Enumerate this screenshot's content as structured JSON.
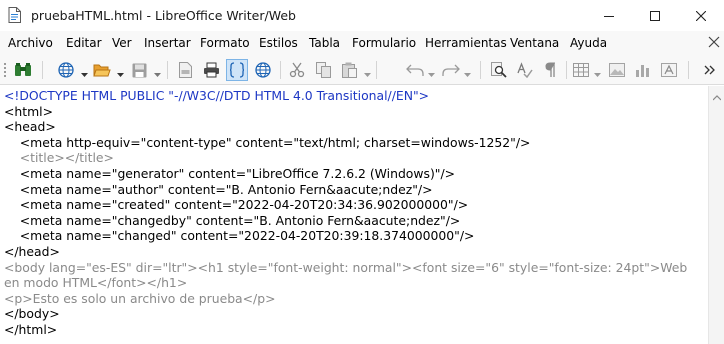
{
  "window": {
    "title": "pruebaHTML.html - LibreOffice Writer/Web",
    "icon": "document-html-icon",
    "controls": [
      "minimize-icon",
      "maximize-icon",
      "close-icon"
    ]
  },
  "menu": {
    "items": [
      "Archivo",
      "Editar",
      "Ver",
      "Insertar",
      "Formato",
      "Estilos",
      "Tabla",
      "Formulario",
      "Herramientas",
      "Ventana",
      "Ayuda"
    ]
  },
  "toolbar": {
    "icons": [
      "find-binoculars-icon",
      "web-browser-icon",
      "open-folder-icon",
      "save-icon",
      "export-pdf-icon",
      "print-icon",
      "html-source-icon",
      "web-view-icon",
      "cut-icon",
      "copy-icon",
      "paste-icon",
      "undo-icon",
      "redo-icon",
      "find-replace-icon",
      "spellcheck-icon",
      "formatting-marks-icon",
      "insert-table-icon",
      "insert-image-icon",
      "insert-chart-icon",
      "insert-textbox-icon",
      "more-options-icon"
    ]
  },
  "source": {
    "lines": [
      {
        "text": "<!DOCTYPE HTML PUBLIC \"-//W3C//DTD HTML 4.0 Transitional//EN\">",
        "style": "doctype"
      },
      {
        "text": "<html>",
        "style": "tag"
      },
      {
        "text": "<head>",
        "style": "tag"
      },
      {
        "text": "    <meta http-equiv=\"content-type\" content=\"text/html; charset=windows-1252\"/>",
        "style": "tag"
      },
      {
        "text": "    <title></title>",
        "style": "grey"
      },
      {
        "text": "    <meta name=\"generator\" content=\"LibreOffice 7.2.6.2 (Windows)\"/>",
        "style": "tag"
      },
      {
        "text": "    <meta name=\"author\" content=\"B. Antonio Fern&aacute;ndez\"/>",
        "style": "tag"
      },
      {
        "text": "    <meta name=\"created\" content=\"2022-04-20T20:34:36.902000000\"/>",
        "style": "tag"
      },
      {
        "text": "    <meta name=\"changedby\" content=\"B. Antonio Fern&aacute;ndez\"/>",
        "style": "tag"
      },
      {
        "text": "    <meta name=\"changed\" content=\"2022-04-20T20:39:18.374000000\"/>",
        "style": "tag"
      },
      {
        "text": "</head>",
        "style": "tag"
      },
      {
        "text": "<body lang=\"es-ES\" dir=\"ltr\"><h1 style=\"font-weight: normal\"><font size=\"6\" style=\"font-size: 24pt\">Web",
        "style": "grey"
      },
      {
        "text": "en modo HTML</font></h1>",
        "style": "grey"
      },
      {
        "text": "<p>Esto es solo un archivo de prueba</p>",
        "style": "grey"
      },
      {
        "text": "</body>",
        "style": "tag"
      },
      {
        "text": "</html>",
        "style": "tag"
      }
    ]
  },
  "colors": {
    "doctype": "#1d37c4",
    "grey_text": "#8a8a8a",
    "chrome": "#f8f8f8"
  }
}
